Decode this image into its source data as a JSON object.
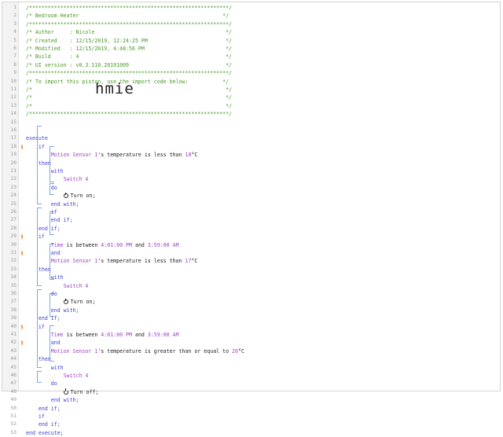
{
  "lines": [
    {
      "n": "1",
      "segments": [
        {
          "t": "/****************************************************************/",
          "c": "cmt"
        }
      ]
    },
    {
      "n": "2",
      "segments": [
        {
          "t": "/* Bedroom Heater                                              */",
          "c": "cmt"
        }
      ]
    },
    {
      "n": "3",
      "segments": [
        {
          "t": "/****************************************************************/",
          "c": "cmt"
        }
      ]
    },
    {
      "n": "4",
      "segments": [
        {
          "t": "/* Author     : Nicole                                          */",
          "c": "cmt"
        }
      ]
    },
    {
      "n": "5",
      "segments": [
        {
          "t": "/* Created    : 12/15/2019, 12:24:25 PM                         */",
          "c": "cmt"
        }
      ]
    },
    {
      "n": "6",
      "segments": [
        {
          "t": "/* Modified   : 12/15/2019, 4:48:56 PM                          */",
          "c": "cmt"
        }
      ]
    },
    {
      "n": "7",
      "segments": [
        {
          "t": "/* Build      : 4                                               */",
          "c": "cmt"
        }
      ]
    },
    {
      "n": "8",
      "segments": [
        {
          "t": "/* UI version : v0.3.110.20191009                               */",
          "c": "cmt"
        }
      ]
    },
    {
      "n": "9",
      "segments": [
        {
          "t": "/****************************************************************/",
          "c": "cmt"
        }
      ]
    },
    {
      "n": "10",
      "segments": [
        {
          "t": "/* To import this piston, use the import code below:           */",
          "c": "cmt"
        }
      ]
    },
    {
      "n": "11",
      "segments": [
        {
          "t": "/*                                                              */",
          "c": "cmt"
        }
      ]
    },
    {
      "n": "12",
      "segments": [
        {
          "t": "/*                                                              */",
          "c": "cmt"
        }
      ]
    },
    {
      "n": "13",
      "segments": [
        {
          "t": "/*                                                              */",
          "c": "cmt"
        }
      ]
    },
    {
      "n": "14",
      "segments": [
        {
          "t": "/****************************************************************/",
          "c": "cmt"
        }
      ]
    },
    {
      "n": "15",
      "segments": []
    },
    {
      "n": "16",
      "segments": []
    },
    {
      "n": "17",
      "segments": [
        {
          "t": "execute",
          "c": "kw"
        }
      ]
    },
    {
      "n": "18",
      "segments": [
        {
          "t": "    if",
          "c": "kw"
        }
      ]
    },
    {
      "n": "19",
      "segments": [
        {
          "t": "        "
        },
        {
          "t": "Motion Sensor 1",
          "c": "dev"
        },
        {
          "t": "'s temperature is less than "
        },
        {
          "t": "18",
          "c": "num"
        },
        {
          "t": "°C"
        }
      ]
    },
    {
      "n": "20",
      "segments": [
        {
          "t": "    then",
          "c": "kw"
        }
      ]
    },
    {
      "n": "21",
      "segments": [
        {
          "t": "        with",
          "c": "kw"
        }
      ]
    },
    {
      "n": "22",
      "segments": [
        {
          "t": "            "
        },
        {
          "t": "Switch 4",
          "c": "dev"
        }
      ]
    },
    {
      "n": "23",
      "segments": [
        {
          "t": "        do",
          "c": "kw"
        }
      ]
    },
    {
      "n": "24",
      "segments": [
        {
          "t": "            "
        },
        {
          "t": "Turn on;",
          "p": "on"
        }
      ]
    },
    {
      "n": "25",
      "segments": [
        {
          "t": "        end with;",
          "c": "kw"
        }
      ]
    },
    {
      "n": "26",
      "segments": [
        {
          "t": "        if",
          "c": "kw"
        }
      ]
    },
    {
      "n": "27",
      "segments": [
        {
          "t": "        end if;",
          "c": "kw"
        }
      ]
    },
    {
      "n": "28",
      "segments": [
        {
          "t": "    end if;",
          "c": "kw"
        }
      ]
    },
    {
      "n": "29",
      "segments": [
        {
          "t": "    if",
          "c": "kw"
        }
      ]
    },
    {
      "n": "30",
      "segments": [
        {
          "t": "        "
        },
        {
          "t": "Time",
          "c": "dev"
        },
        {
          "t": " is between "
        },
        {
          "t": "4:01:00 PM",
          "c": "num"
        },
        {
          "t": " and "
        },
        {
          "t": "3:59:00 AM",
          "c": "num"
        }
      ]
    },
    {
      "n": "31",
      "segments": [
        {
          "t": "        and",
          "c": "kw"
        }
      ]
    },
    {
      "n": "32",
      "segments": [
        {
          "t": "        "
        },
        {
          "t": "Motion Sensor 1",
          "c": "dev"
        },
        {
          "t": "'s temperature is less than "
        },
        {
          "t": "17",
          "c": "num"
        },
        {
          "t": "°C"
        }
      ]
    },
    {
      "n": "33",
      "segments": [
        {
          "t": "    then",
          "c": "kw"
        }
      ]
    },
    {
      "n": "34",
      "segments": [
        {
          "t": "        with",
          "c": "kw"
        }
      ]
    },
    {
      "n": "35",
      "segments": [
        {
          "t": "            "
        },
        {
          "t": "Switch 4",
          "c": "dev"
        }
      ]
    },
    {
      "n": "36",
      "segments": [
        {
          "t": "        do",
          "c": "kw"
        }
      ]
    },
    {
      "n": "37",
      "segments": [
        {
          "t": "            "
        },
        {
          "t": "Turn on;",
          "p": "on"
        }
      ]
    },
    {
      "n": "38",
      "segments": [
        {
          "t": "        end with;",
          "c": "kw"
        }
      ]
    },
    {
      "n": "39",
      "segments": [
        {
          "t": "    end if;",
          "c": "kw"
        }
      ]
    },
    {
      "n": "40",
      "segments": [
        {
          "t": "    if",
          "c": "kw"
        }
      ]
    },
    {
      "n": "41",
      "segments": [
        {
          "t": "        "
        },
        {
          "t": "Time",
          "c": "dev"
        },
        {
          "t": " is between "
        },
        {
          "t": "4:01:00 PM",
          "c": "num"
        },
        {
          "t": " and "
        },
        {
          "t": "3:59:00 AM",
          "c": "num"
        }
      ]
    },
    {
      "n": "42",
      "segments": [
        {
          "t": "        and",
          "c": "kw"
        }
      ]
    },
    {
      "n": "43",
      "segments": [
        {
          "t": "        "
        },
        {
          "t": "Motion Sensor 1",
          "c": "dev"
        },
        {
          "t": "'s temperature is greater than or equal to "
        },
        {
          "t": "20",
          "c": "num"
        },
        {
          "t": "°C"
        }
      ]
    },
    {
      "n": "44",
      "segments": [
        {
          "t": "    then",
          "c": "kw"
        }
      ]
    },
    {
      "n": "45",
      "segments": [
        {
          "t": "        with",
          "c": "kw"
        }
      ]
    },
    {
      "n": "46",
      "segments": [
        {
          "t": "            "
        },
        {
          "t": "Switch 4",
          "c": "dev"
        }
      ]
    },
    {
      "n": "47",
      "segments": [
        {
          "t": "        do",
          "c": "kw"
        }
      ]
    },
    {
      "n": "48",
      "segments": [
        {
          "t": "            "
        },
        {
          "t": "Turn off;",
          "p": "off"
        }
      ]
    },
    {
      "n": "49",
      "segments": [
        {
          "t": "        end with;",
          "c": "kw"
        }
      ]
    },
    {
      "n": "50",
      "segments": [
        {
          "t": "    end if;",
          "c": "kw"
        }
      ]
    },
    {
      "n": "51",
      "segments": [
        {
          "t": "    if",
          "c": "kw"
        }
      ]
    },
    {
      "n": "52",
      "segments": [
        {
          "t": "    end if;",
          "c": "kw"
        }
      ]
    },
    {
      "n": "53",
      "segments": [
        {
          "t": "end execute;",
          "c": "kw"
        }
      ]
    }
  ],
  "import_code": "hmie",
  "marked_lines": [
    "18",
    "29",
    "31",
    "40",
    "42"
  ],
  "marker_symbol": "§"
}
